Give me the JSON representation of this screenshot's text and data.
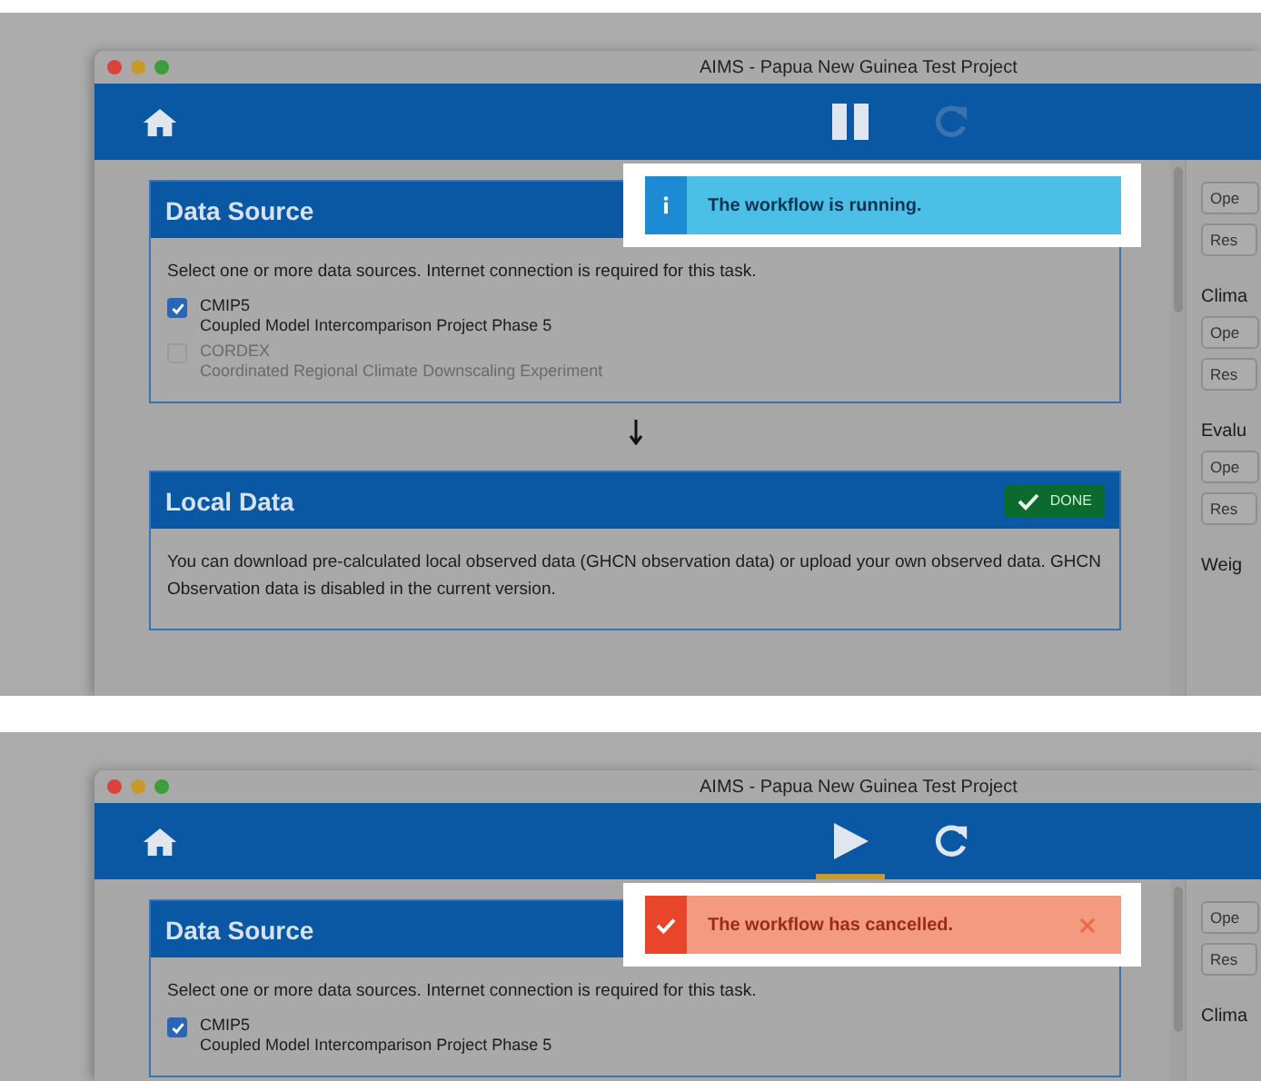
{
  "screenshots": [
    {
      "window": {
        "title": "AIMS - Papua New Guinea Test Project"
      },
      "toolbar": {
        "primary_button": {
          "kind": "pause",
          "selected": false
        },
        "reload_button": {
          "disabled": true
        }
      },
      "toast": {
        "kind": "info",
        "message": "The workflow is running."
      },
      "sections": [
        {
          "title": "Data Source",
          "description": "Select one or more data sources. Internet connection is required for this task.",
          "options": [
            {
              "label": "CMIP5",
              "detail": "Coupled Model Intercomparison Project Phase 5",
              "checked": true,
              "disabled": false
            },
            {
              "label": "CORDEX",
              "detail": "Coordinated Regional Climate Downscaling Experiment",
              "checked": false,
              "disabled": true
            }
          ]
        },
        {
          "title": "Local Data",
          "done": true,
          "badge": "DONE",
          "description": "You can download pre-calculated local observed data (GHCN observation data) or upload your own observed data. GHCN Observation data is disabled in the current version."
        }
      ],
      "side_panel": [
        {
          "buttons": [
            "Ope",
            "Res"
          ]
        },
        {
          "heading": "Clima",
          "buttons": [
            "Ope",
            "Res"
          ]
        },
        {
          "heading": "Evalu",
          "buttons": [
            "Ope",
            "Res"
          ]
        },
        {
          "heading": "Weig"
        }
      ]
    },
    {
      "window": {
        "title": "AIMS - Papua New Guinea Test Project"
      },
      "toolbar": {
        "primary_button": {
          "kind": "play",
          "selected": true
        },
        "reload_button": {
          "disabled": false
        }
      },
      "toast": {
        "kind": "error",
        "message": "The workflow has cancelled.",
        "closable": true
      },
      "sections": [
        {
          "title": "Data Source",
          "description": "Select one or more data sources. Internet connection is required for this task.",
          "options": [
            {
              "label": "CMIP5",
              "detail": "Coupled Model Intercomparison Project Phase 5",
              "checked": true,
              "disabled": false
            }
          ]
        }
      ],
      "side_panel": [
        {
          "buttons": [
            "Ope",
            "Res"
          ]
        },
        {
          "heading": "Clima"
        }
      ]
    }
  ]
}
